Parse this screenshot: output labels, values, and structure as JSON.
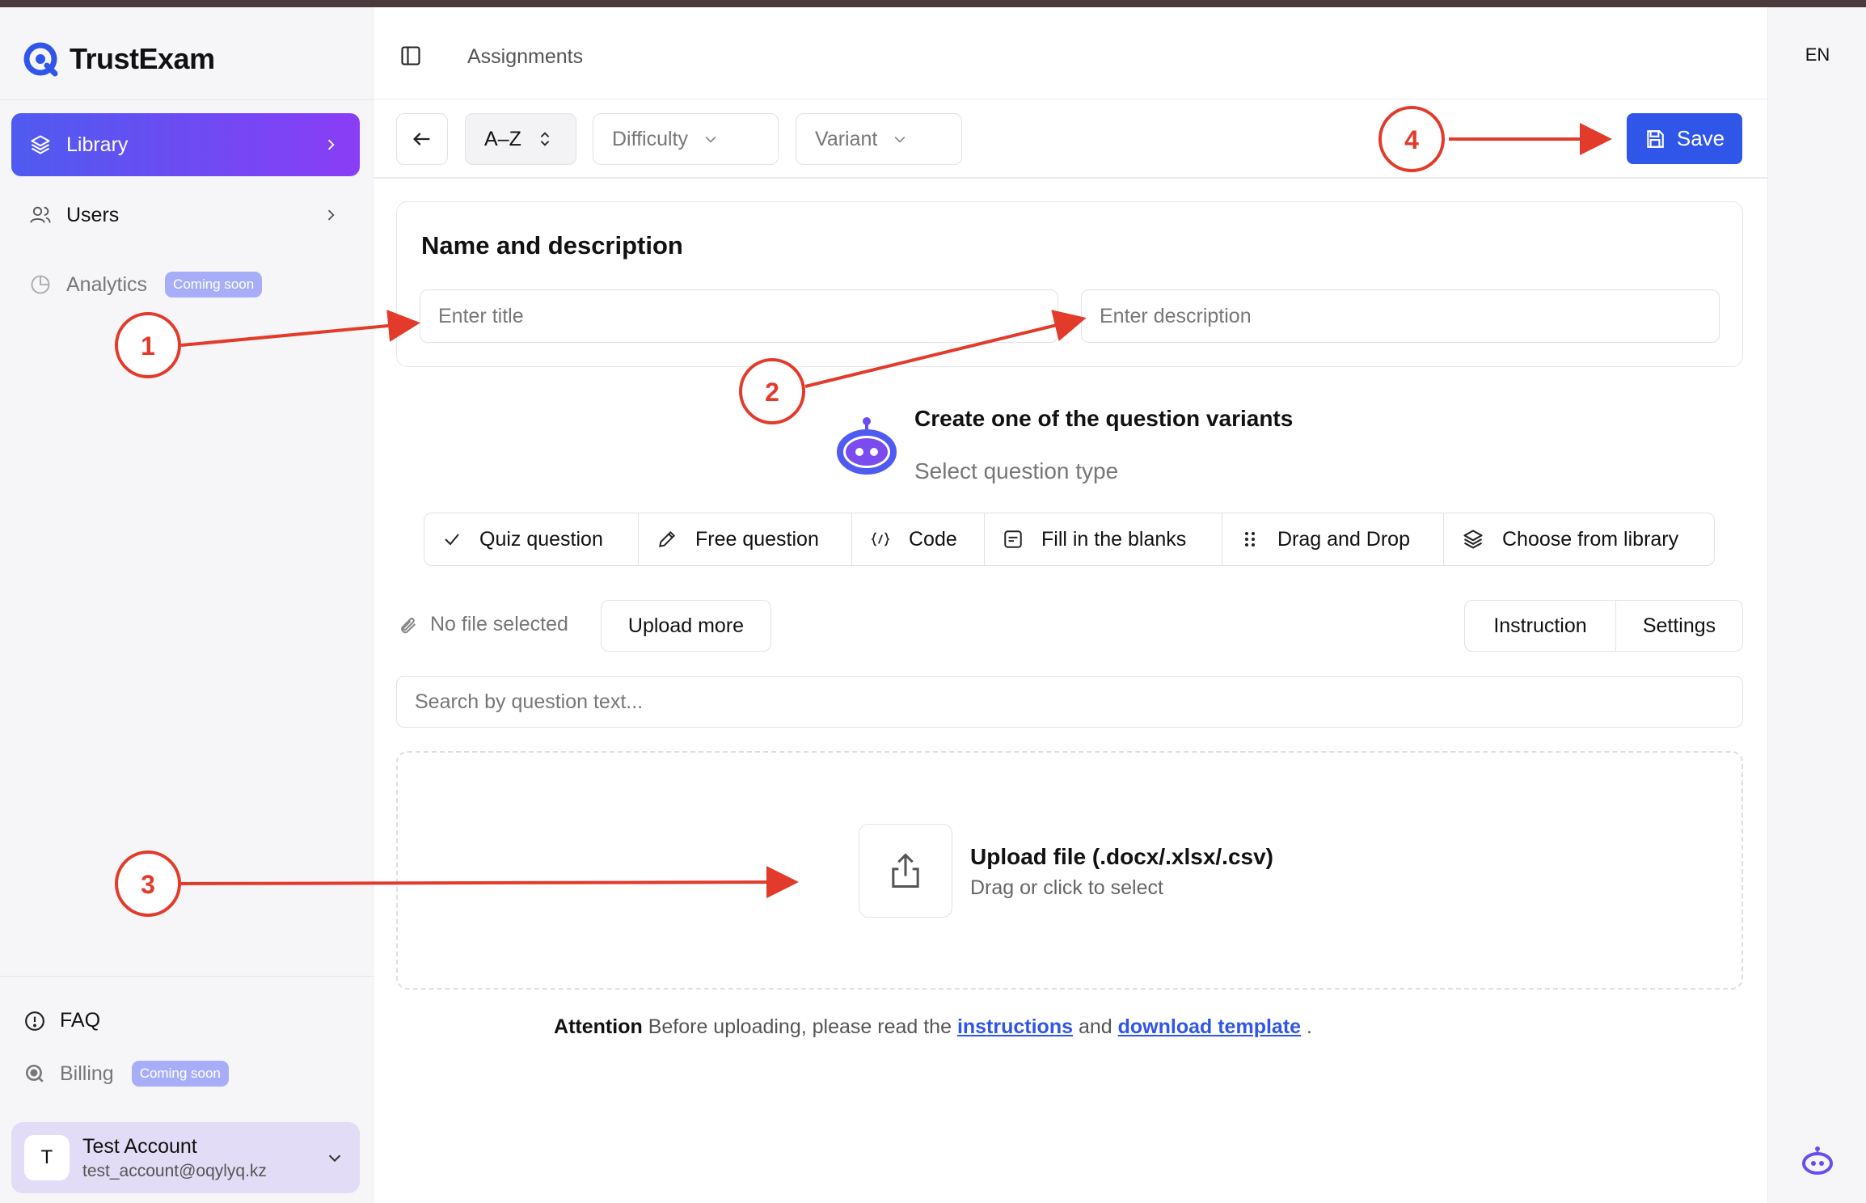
{
  "app": {
    "name": "TrustExam"
  },
  "sidebar": {
    "items": [
      {
        "label": "Library"
      },
      {
        "label": "Users"
      },
      {
        "label": "Analytics",
        "badge": "Coming soon"
      }
    ],
    "bottom": [
      {
        "label": "FAQ"
      },
      {
        "label": "Billing",
        "badge": "Coming soon"
      }
    ],
    "account": {
      "initial": "T",
      "name": "Test Account",
      "email": "test_account@oqylyq.kz"
    }
  },
  "header": {
    "breadcrumb": "Assignments",
    "language": "EN"
  },
  "toolbar": {
    "sort_label": "A–Z",
    "difficulty_placeholder": "Difficulty",
    "variant_placeholder": "Variant",
    "save_label": "Save"
  },
  "form": {
    "section_title": "Name and description",
    "title_placeholder": "Enter title",
    "description_placeholder": "Enter description"
  },
  "variants": {
    "title": "Create one of the question variants",
    "subtitle": "Select question type",
    "types": [
      {
        "label": "Quiz question",
        "icon": "check-icon"
      },
      {
        "label": "Free question",
        "icon": "pencil-icon"
      },
      {
        "label": "Code",
        "icon": "code-icon"
      },
      {
        "label": "Fill in the blanks",
        "icon": "text-box-icon"
      },
      {
        "label": "Drag and Drop",
        "icon": "grip-icon"
      },
      {
        "label": "Choose from library",
        "icon": "layers-icon"
      }
    ]
  },
  "files": {
    "status": "No file selected",
    "upload_more": "Upload more",
    "instruction": "Instruction",
    "settings": "Settings"
  },
  "search": {
    "placeholder": "Search by question text..."
  },
  "upload": {
    "title": "Upload file (.docx/.xlsx/.csv)",
    "subtitle": "Drag or click to select"
  },
  "attention": {
    "label": "Attention",
    "text": "Before uploading, please read the",
    "link1": "instructions",
    "and": "and",
    "link2": "download template",
    "end": "."
  },
  "annotations": [
    "1",
    "2",
    "3",
    "4"
  ],
  "colors": {
    "accent": "#2f56e8",
    "annotation": "#e23b2b",
    "gradient_start": "#4f5bf0",
    "gradient_end": "#8a3df5"
  }
}
